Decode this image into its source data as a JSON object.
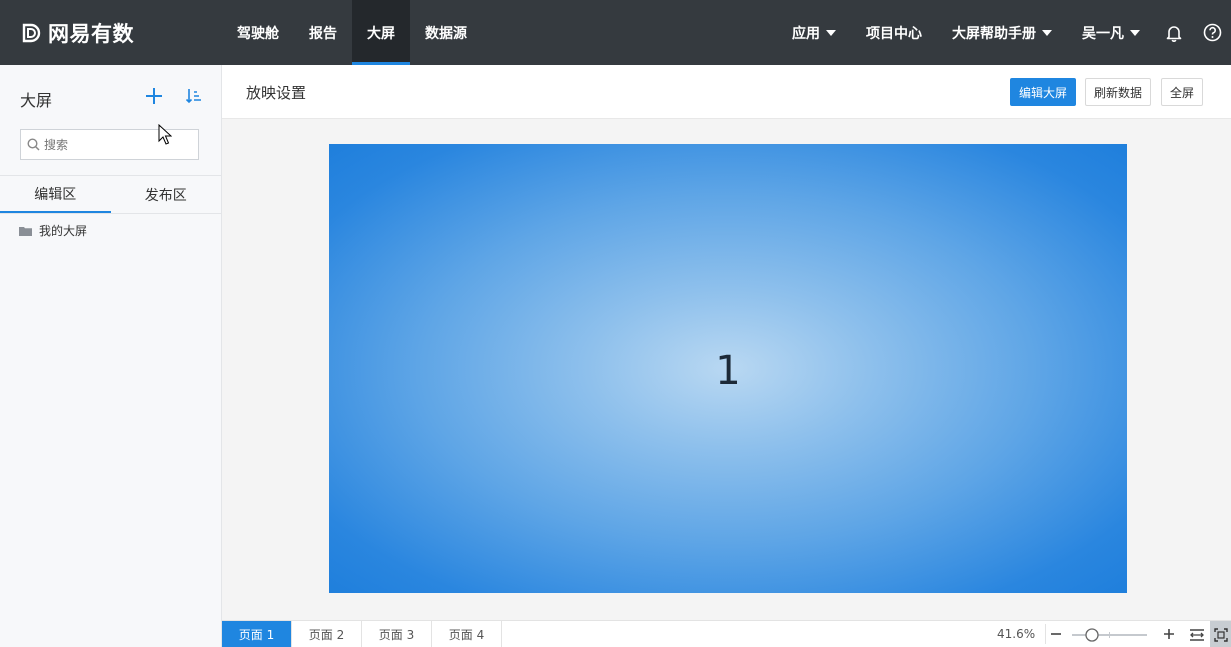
{
  "app": {
    "logo_text": "网易有数"
  },
  "nav": {
    "items": [
      {
        "label": "驾驶舱"
      },
      {
        "label": "报告"
      },
      {
        "label": "大屏"
      },
      {
        "label": "数据源"
      }
    ],
    "active_index": 2
  },
  "right_nav": {
    "apps_label": "应用",
    "project_center_label": "项目中心",
    "help_label": "大屏帮助手册",
    "user_label": "吴一凡",
    "icons": [
      "bell-icon",
      "help-icon"
    ]
  },
  "sidebar": {
    "title": "大屏",
    "search_placeholder": "搜索",
    "tabs": [
      {
        "label": "编辑区"
      },
      {
        "label": "发布区"
      }
    ],
    "active_tab": 0,
    "tree": [
      {
        "label": "我的大屏",
        "icon": "folder-icon"
      }
    ]
  },
  "main": {
    "title": "放映设置",
    "buttons": {
      "edit": "编辑大屏",
      "refresh": "刷新数据",
      "fullscreen": "全屏"
    },
    "canvas_label": "1"
  },
  "bottom": {
    "pages": [
      {
        "label": "页面 1"
      },
      {
        "label": "页面 2"
      },
      {
        "label": "页面 3"
      },
      {
        "label": "页面 4"
      }
    ],
    "active_page": 0,
    "zoom": "41.6%"
  },
  "colors": {
    "topbar": "#353a3f",
    "accent": "#1f86e0",
    "sidebar_bg": "#f7f8fa"
  }
}
